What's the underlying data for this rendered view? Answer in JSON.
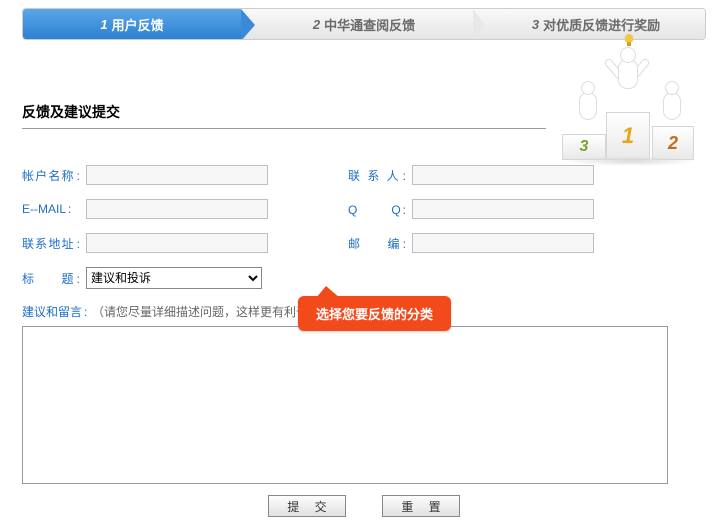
{
  "stepper": {
    "steps": [
      {
        "num": "1",
        "label": "用户反馈",
        "active": true
      },
      {
        "num": "2",
        "label": "中华通查阅反馈",
        "active": false
      },
      {
        "num": "3",
        "label": "对优质反馈进行奖励",
        "active": false
      }
    ]
  },
  "podium": {
    "p1": "1",
    "p2": "2",
    "p3": "3"
  },
  "heading": "反馈及建议提交",
  "form": {
    "account_label": "帐户名称",
    "contact_label": "联 系 人",
    "email_label": "E--MAIL",
    "qq_label": "Q　　Q",
    "address_label": "联系地址",
    "postcode_label": "邮　　编",
    "title_label": "标　　题",
    "title_select_value": "建议和投诉",
    "message_label": "建议和留言",
    "message_hint": "（请您尽量详细描述问题，这样更有利于我们协调处理您的意见）",
    "account_value": "",
    "contact_value": "",
    "email_value": "",
    "qq_value": "",
    "address_value": "",
    "postcode_value": "",
    "message_value": ""
  },
  "buttons": {
    "submit": "提 交",
    "reset": "重 置"
  },
  "tooltip": "选择您要反馈的分类"
}
